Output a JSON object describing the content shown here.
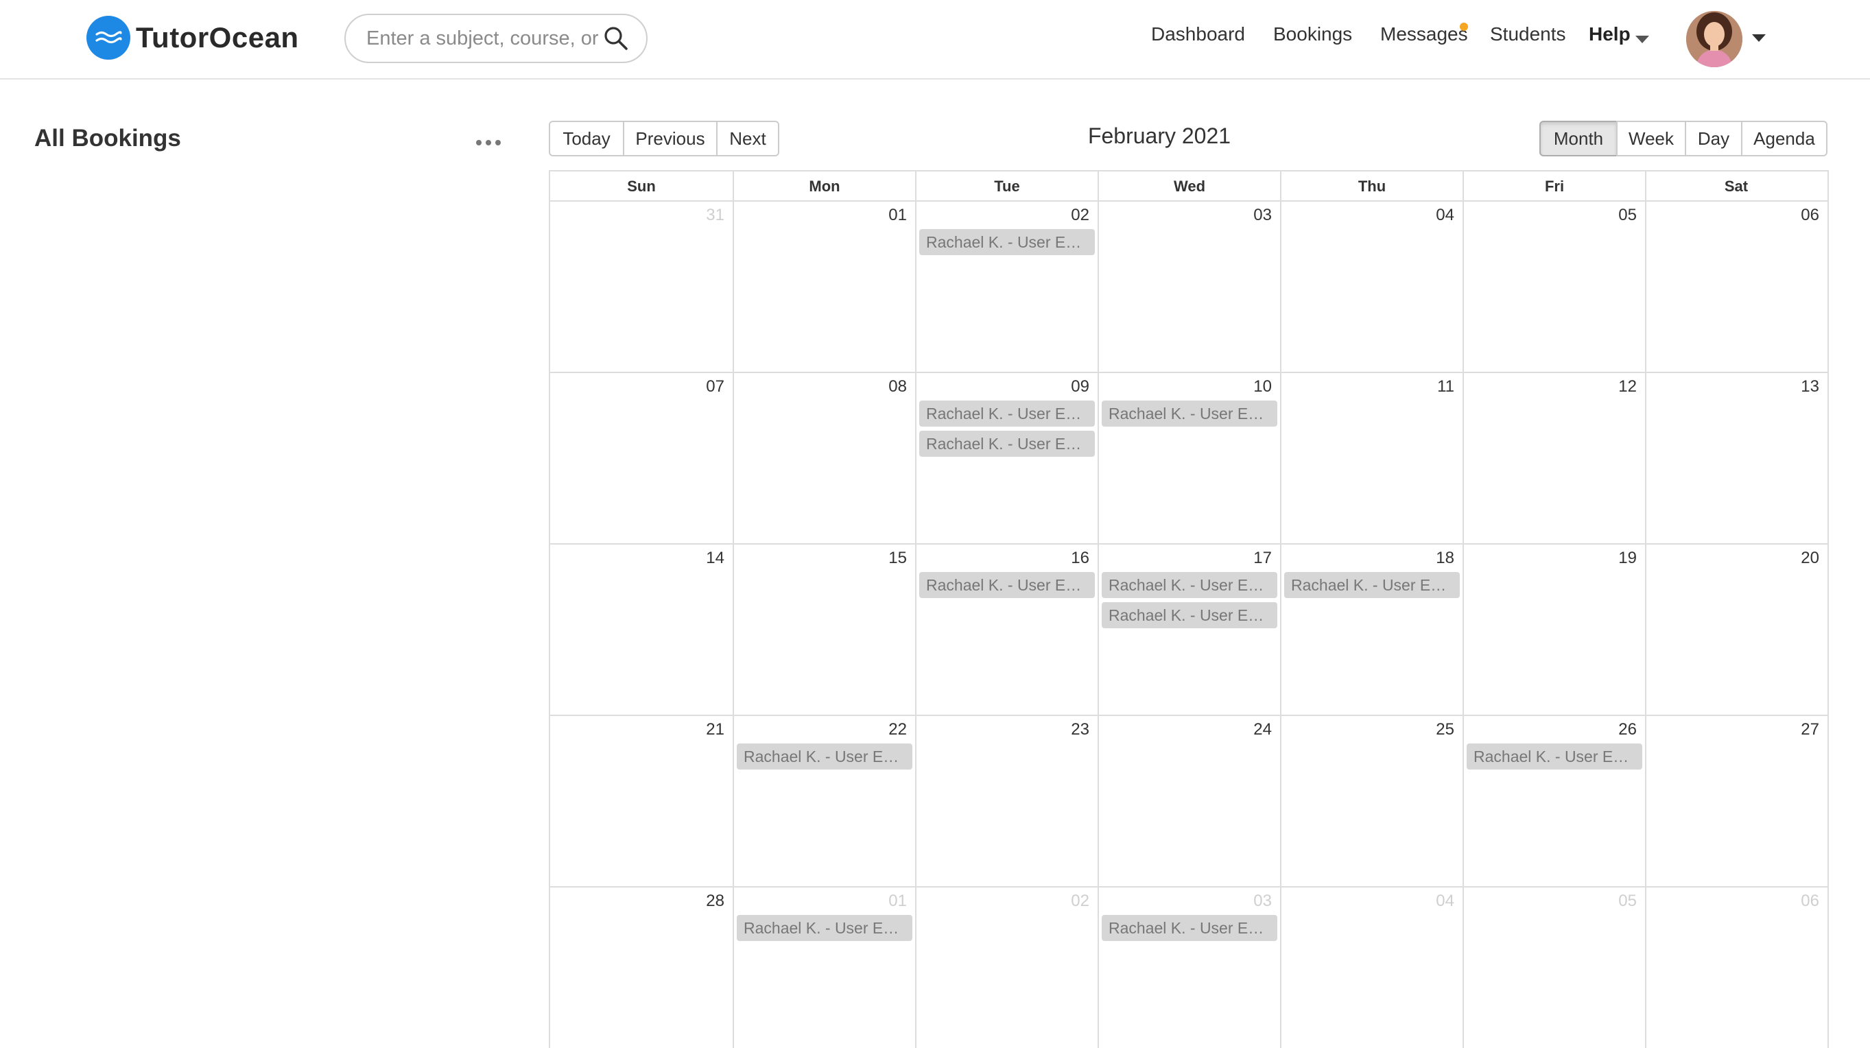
{
  "app": {
    "name": "TutorOcean",
    "brand_color": "#1e88e5",
    "event_color": "#d6d6d6"
  },
  "search": {
    "placeholder": "Enter a subject, course, or topic",
    "icon": "search-icon"
  },
  "nav": {
    "dashboard": "Dashboard",
    "bookings": "Bookings",
    "messages": "Messages",
    "students": "Students",
    "help": "Help",
    "messages_notification_color": "#f5a623"
  },
  "sidebar": {
    "title": "All Bookings",
    "more_icon": "more-horizontal-icon"
  },
  "toolbar": {
    "today": "Today",
    "previous": "Previous",
    "next": "Next",
    "title": "February 2021",
    "views": [
      "Month",
      "Week",
      "Day",
      "Agenda"
    ],
    "active_view": "Month"
  },
  "calendar": {
    "weekdays": [
      "Sun",
      "Mon",
      "Tue",
      "Wed",
      "Thu",
      "Fri",
      "Sat"
    ],
    "weeks": [
      [
        {
          "day": "31",
          "off": true,
          "events": []
        },
        {
          "day": "01",
          "off": false,
          "events": []
        },
        {
          "day": "02",
          "off": false,
          "events": [
            "Rachael K. - User Experience"
          ]
        },
        {
          "day": "03",
          "off": false,
          "events": []
        },
        {
          "day": "04",
          "off": false,
          "events": []
        },
        {
          "day": "05",
          "off": false,
          "events": []
        },
        {
          "day": "06",
          "off": false,
          "events": []
        }
      ],
      [
        {
          "day": "07",
          "off": false,
          "events": []
        },
        {
          "day": "08",
          "off": false,
          "events": []
        },
        {
          "day": "09",
          "off": false,
          "events": [
            "Rachael K. - User Experience",
            "Rachael K. - User Experience"
          ]
        },
        {
          "day": "10",
          "off": false,
          "events": [
            "Rachael K. - User Experience"
          ]
        },
        {
          "day": "11",
          "off": false,
          "events": []
        },
        {
          "day": "12",
          "off": false,
          "events": []
        },
        {
          "day": "13",
          "off": false,
          "events": []
        }
      ],
      [
        {
          "day": "14",
          "off": false,
          "events": []
        },
        {
          "day": "15",
          "off": false,
          "events": []
        },
        {
          "day": "16",
          "off": false,
          "events": [
            "Rachael K. - User Experience"
          ]
        },
        {
          "day": "17",
          "off": false,
          "events": [
            "Rachael K. - User Experience",
            "Rachael K. - User Experience"
          ]
        },
        {
          "day": "18",
          "off": false,
          "events": [
            "Rachael K. - User Experience"
          ]
        },
        {
          "day": "19",
          "off": false,
          "events": []
        },
        {
          "day": "20",
          "off": false,
          "events": []
        }
      ],
      [
        {
          "day": "21",
          "off": false,
          "events": []
        },
        {
          "day": "22",
          "off": false,
          "events": [
            "Rachael K. - User Experience"
          ]
        },
        {
          "day": "23",
          "off": false,
          "events": []
        },
        {
          "day": "24",
          "off": false,
          "events": []
        },
        {
          "day": "25",
          "off": false,
          "events": []
        },
        {
          "day": "26",
          "off": false,
          "events": [
            "Rachael K. - User Experience"
          ]
        },
        {
          "day": "27",
          "off": false,
          "events": []
        }
      ],
      [
        {
          "day": "28",
          "off": false,
          "events": []
        },
        {
          "day": "01",
          "off": true,
          "events": [
            "Rachael K. - User Experience"
          ]
        },
        {
          "day": "02",
          "off": true,
          "events": []
        },
        {
          "day": "03",
          "off": true,
          "events": [
            "Rachael K. - User Experience"
          ]
        },
        {
          "day": "04",
          "off": true,
          "events": []
        },
        {
          "day": "05",
          "off": true,
          "events": []
        },
        {
          "day": "06",
          "off": true,
          "events": []
        }
      ]
    ]
  }
}
